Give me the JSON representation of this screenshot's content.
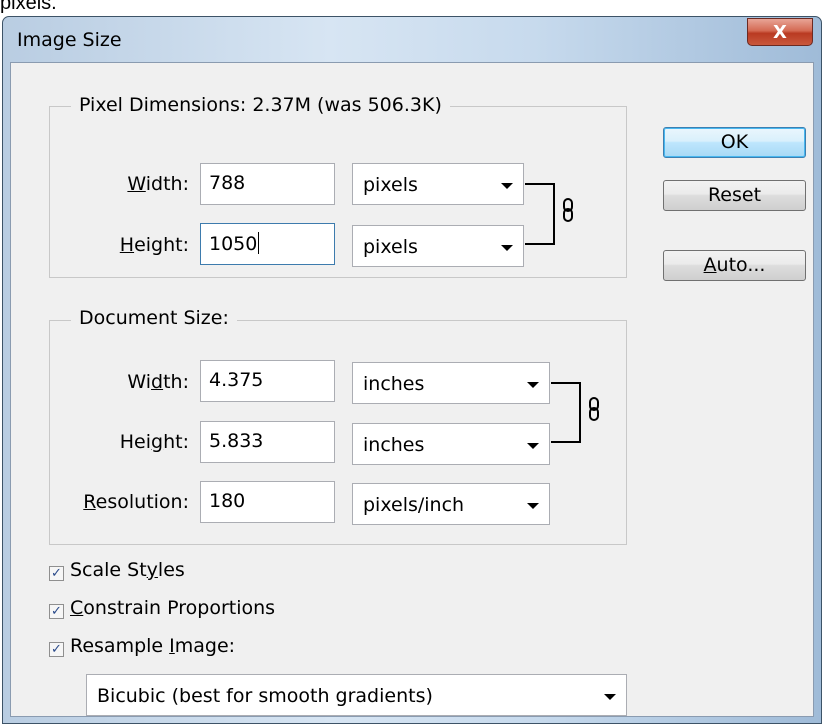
{
  "background_caption": "pixels.",
  "window": {
    "title": "Image Size",
    "close_glyph": "X"
  },
  "pixel_dimensions": {
    "legend": "Pixel Dimensions:  2.37M (was 506.3K)",
    "width_label": {
      "pre": "",
      "ul": "W",
      "post": "idth:"
    },
    "width_value": "788",
    "width_unit": "pixels",
    "height_label": {
      "pre": "",
      "ul": "H",
      "post": "eight:"
    },
    "height_value": "1050",
    "height_unit": "pixels"
  },
  "document_size": {
    "legend": "Document Size:",
    "width_label": {
      "pre": "Wi",
      "ul": "d",
      "post": "th:"
    },
    "width_value": "4.375",
    "width_unit": "inches",
    "height_label": {
      "pre": "Hei",
      "ul": "g",
      "post": "ht:"
    },
    "height_value": "5.833",
    "height_unit": "inches",
    "resolution_label": {
      "pre": "",
      "ul": "R",
      "post": "esolution:"
    },
    "resolution_value": "180",
    "resolution_unit": "pixels/inch"
  },
  "buttons": {
    "ok": "OK",
    "reset": "Reset",
    "auto": {
      "ul": "A",
      "post": "uto..."
    }
  },
  "options": {
    "scale_styles": {
      "pre": "Scale St",
      "ul": "y",
      "post": "les",
      "checked": true
    },
    "constrain": {
      "pre": "",
      "ul": "C",
      "post": "onstrain Proportions",
      "checked": true
    },
    "resample": {
      "pre": "Resample ",
      "ul": "I",
      "post": "mage:",
      "checked": true
    }
  },
  "resample_method": "Bicubic (best for smooth gradients)",
  "icons": {
    "chain": "chain-link-icon",
    "dropdown": "chevron-down-icon",
    "check": "checkmark-icon"
  }
}
